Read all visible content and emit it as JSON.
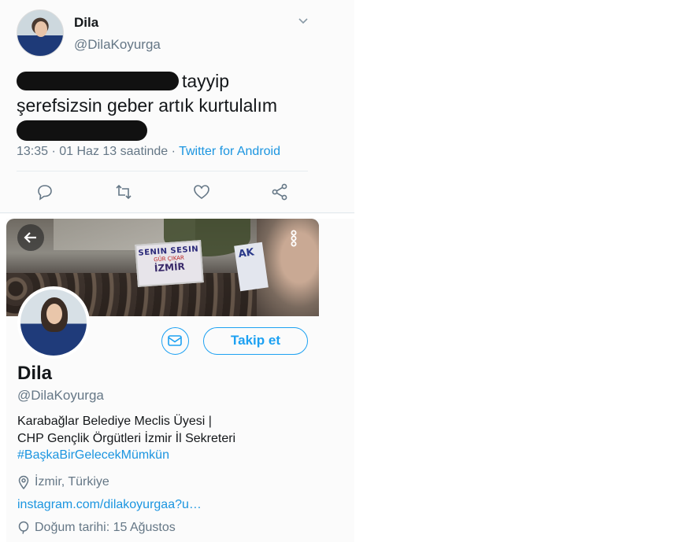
{
  "tweet": {
    "author_name": "Dila",
    "author_handle": "@DilaKoyurga",
    "text_line1_visible": "tayyip",
    "text_line2": "şerefsizsin geber artık kurtulalım",
    "time_text": "13:35 · 01 Haz 13 saatinde · ",
    "source_app": "Twitter for Android",
    "actions": [
      "reply-icon",
      "retweet-icon",
      "like-icon",
      "share-icon"
    ]
  },
  "profile": {
    "banner_sign_line1": "SENIN SESIN",
    "banner_sign_line2": "GÜR ÇIKAR",
    "banner_sign_line3": "İZMİR",
    "banner_sign2_text": "AK",
    "follow_label": "Takip et",
    "name": "Dila",
    "handle": "@DilaKoyurga",
    "bio_line1": "Karabağlar Belediye Meclis Üyesi |",
    "bio_line2": "CHP Gençlik Örgütleri İzmir İl Sekreteri",
    "bio_hashtag": "#BaşkaBirGelecekMümkün",
    "location": "İzmir, Türkiye",
    "link": "instagram.com/dilakoyurgaa?u…",
    "birthday": "Doğum tarihi: 15 Ağustos"
  },
  "colors": {
    "accent": "#1da1f2",
    "link": "#1b95e0",
    "secondary_text": "#657786",
    "redaction": "#111111"
  }
}
